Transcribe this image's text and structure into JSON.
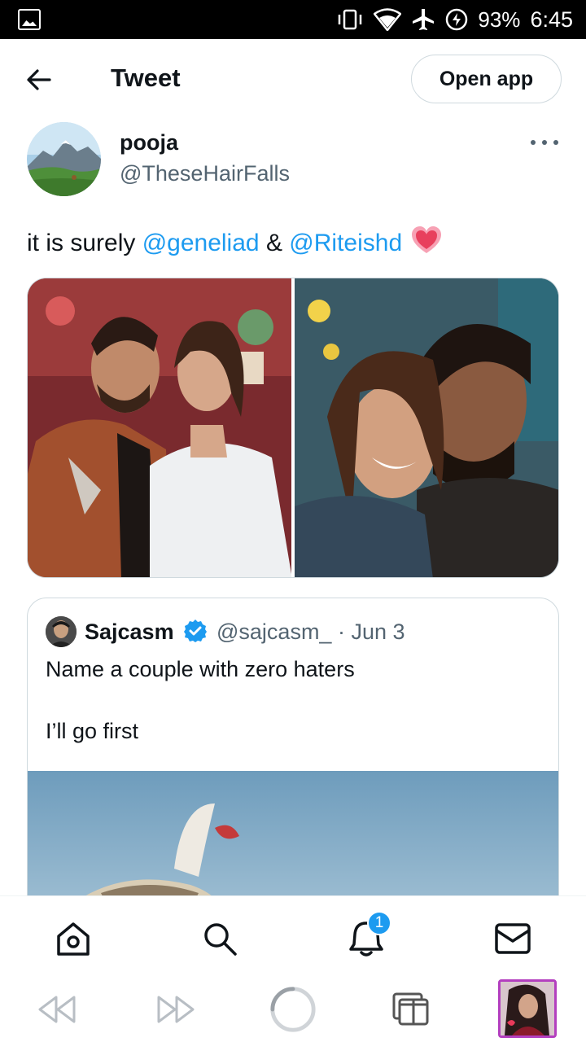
{
  "status_bar": {
    "battery": "93%",
    "time": "6:45",
    "icons": [
      "image-icon",
      "vibrate-icon",
      "wifi-icon",
      "airplane-icon",
      "battery-saver-icon"
    ]
  },
  "header": {
    "title": "Tweet",
    "open_app": "Open app",
    "back_icon": "back-arrow-icon"
  },
  "tweet": {
    "author_name": "pooja",
    "author_handle": "@TheseHairFalls",
    "text_prefix": "it is surely ",
    "mention1": "@geneliad",
    "and": " & ",
    "mention2": "@Riteishd",
    "emoji": "sparkling-heart-icon",
    "media": [
      "photo-couple-1",
      "photo-couple-2"
    ]
  },
  "quote": {
    "name": "Sajcasm",
    "meta": "@sajcasm_ · Jun 3",
    "line1": "Name a couple with zero haters",
    "line2": "I’ll go first"
  },
  "bottom_nav": {
    "items": [
      "home-icon",
      "search-icon",
      "notifications-icon",
      "messages-icon"
    ],
    "notification_count": "1"
  },
  "browser_bar": {
    "items": [
      "rewind-icon",
      "fast-forward-icon",
      "loading-circle-icon",
      "tabs-icon",
      "profile-thumbnail"
    ]
  },
  "colors": {
    "accent": "#1d9bf0",
    "text": "#0f1419",
    "secondary": "#536471",
    "border": "#cfd9de"
  }
}
